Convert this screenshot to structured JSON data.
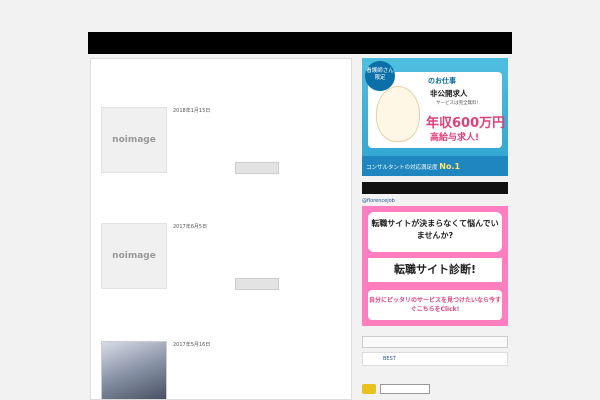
{
  "site": {
    "title": "",
    "description": ""
  },
  "nav": {
    "items": [
      "",
      "",
      "",
      "",
      "",
      "",
      "",
      "",
      ""
    ]
  },
  "posts": [
    {
      "title": "",
      "date": "2018年1月15日",
      "category": "",
      "thumb": "noimage",
      "excerpt": "",
      "more": ""
    },
    {
      "title": "",
      "date": "2017年6月5日",
      "category": "",
      "thumb": "noimage",
      "excerpt": "",
      "more": ""
    },
    {
      "title": "",
      "date": "2017年5月16日",
      "category": "",
      "thumb": "",
      "excerpt": "",
      "more": ""
    }
  ],
  "sidebar": {
    "ad1": {
      "line1": "看護師さん",
      "line2": "のお仕事",
      "line3": "非公開求人",
      "line4": "多数!",
      "small": "サービスは完全無料!",
      "big": "年収600万円",
      "big2": "高給与求人!",
      "footer": "コンサルタントの対応満足度",
      "footer_badge": "No.1",
      "badge": "看護師さん限定"
    },
    "rss_label": "",
    "twitter_label": "@florencejob",
    "ad2": {
      "q": "転職サイトが決まらなくて悩んでいませんか?",
      "t": "転職サイト診断!",
      "b": "自分にピッタリのサービスを見つけたいなら今すぐこちらをClick!"
    },
    "widget_title": "",
    "rank_item": "BEST"
  }
}
